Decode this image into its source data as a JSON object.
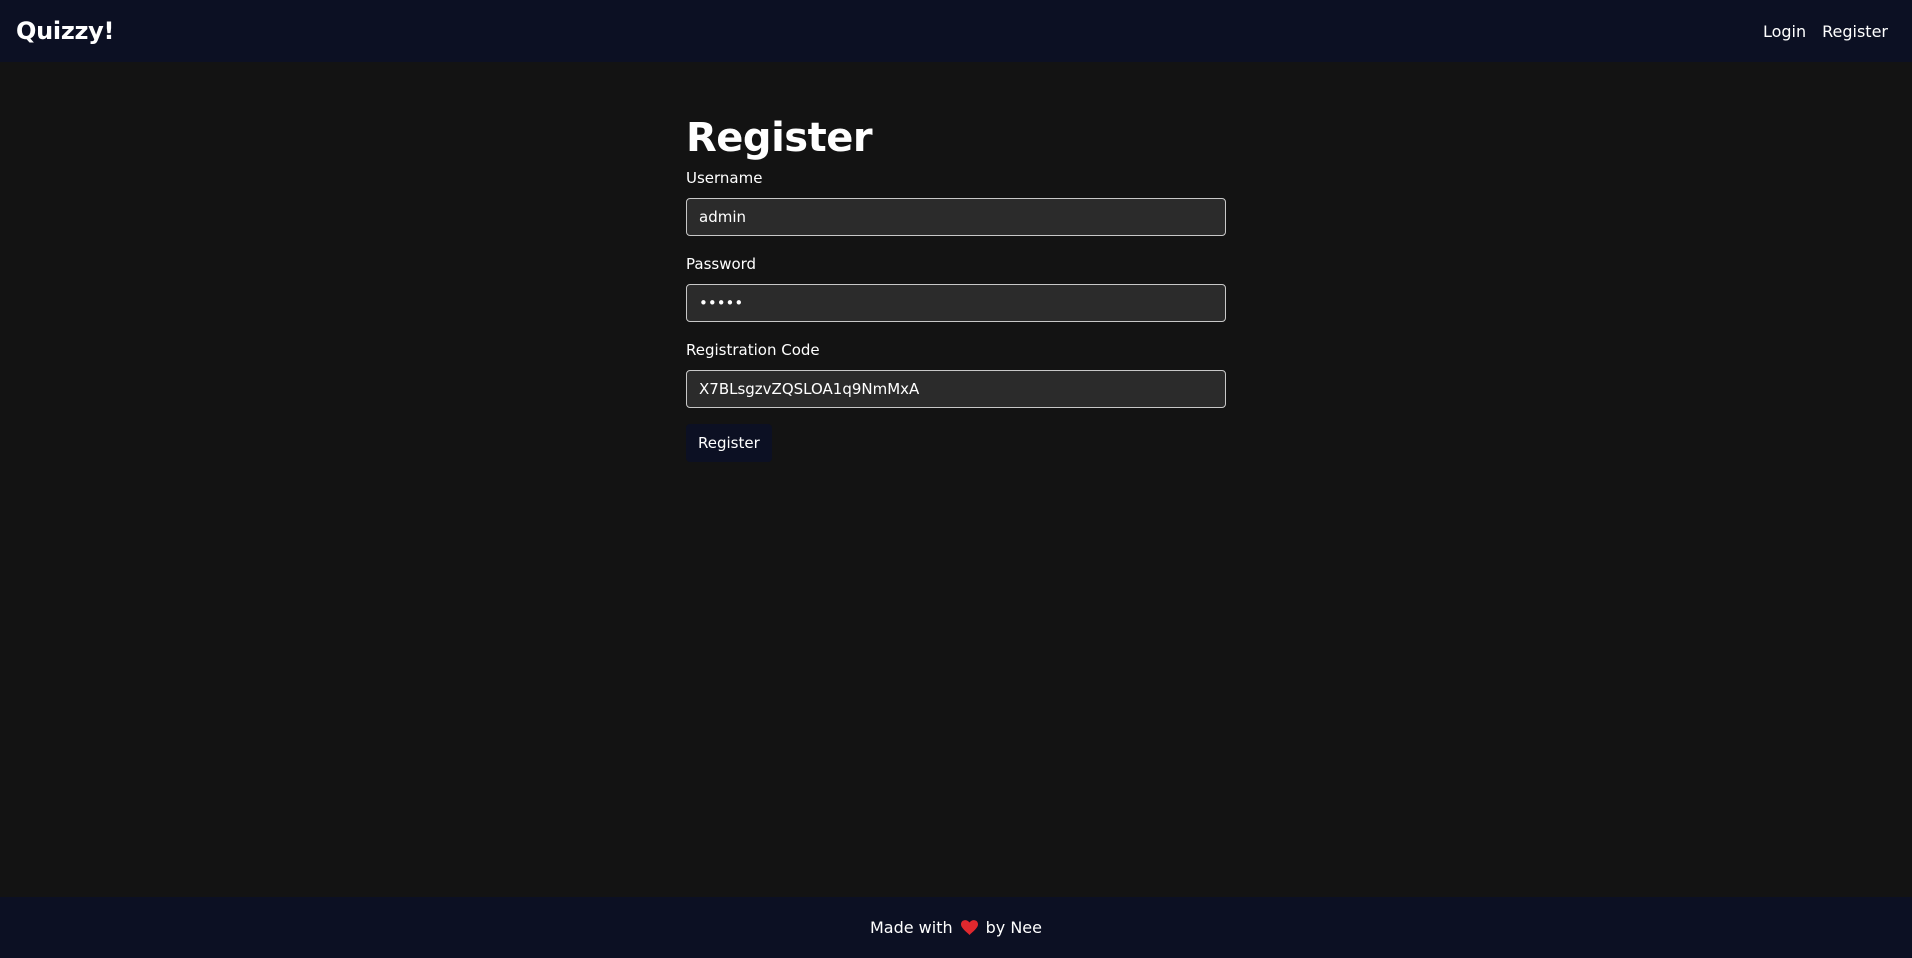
{
  "navbar": {
    "brand": "Quizzy!",
    "links": [
      {
        "label": "Login"
      },
      {
        "label": "Register"
      }
    ]
  },
  "form": {
    "title": "Register",
    "username": {
      "label": "Username",
      "value": "admin"
    },
    "password": {
      "label": "Password",
      "value": "•••••"
    },
    "registration_code": {
      "label": "Registration Code",
      "value": "X7BLsgzvZQSLOA1q9NmMxA"
    },
    "submit_label": "Register"
  },
  "footer": {
    "prefix": "Made with",
    "icon": "heart-icon",
    "suffix": "by Nee"
  },
  "colors": {
    "navbar_bg": "#0c1023",
    "page_bg": "#131313",
    "input_bg": "#2b2b2b",
    "heart": "#e0282e"
  }
}
